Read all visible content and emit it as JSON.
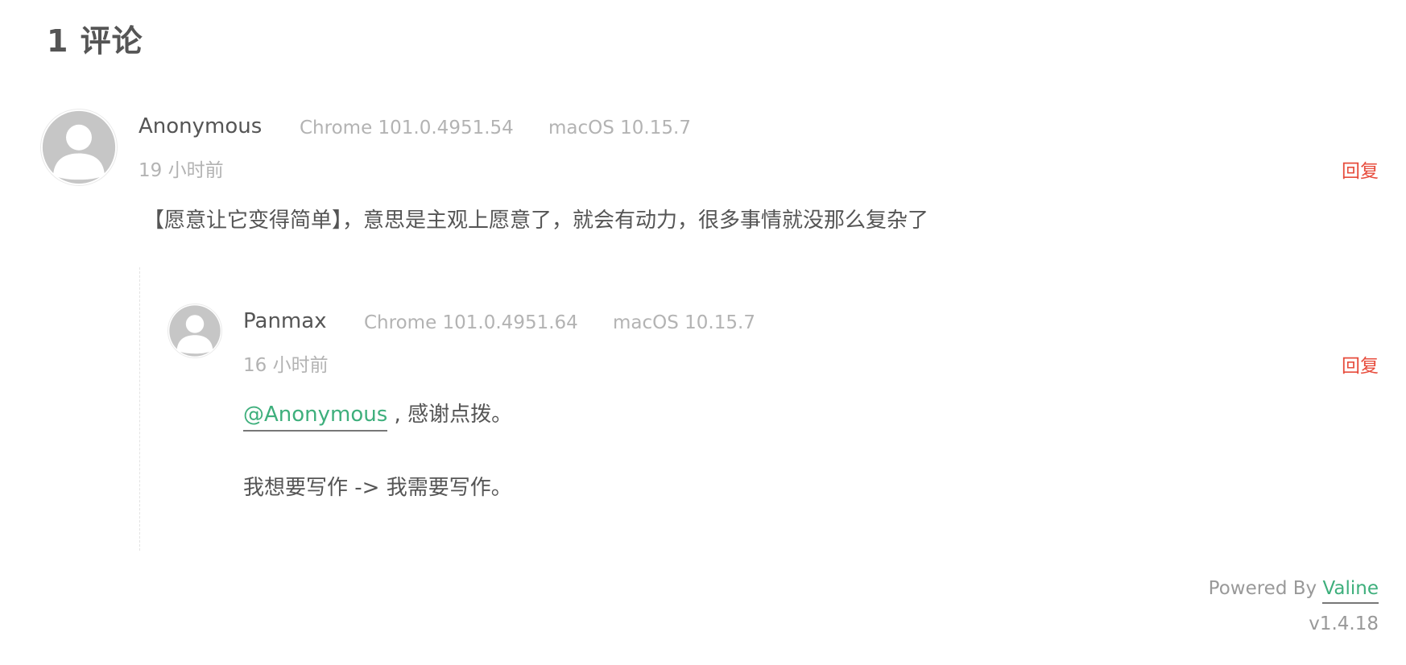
{
  "header": {
    "count_title": "1 评论"
  },
  "comments": [
    {
      "nick": "Anonymous",
      "browser": "Chrome 101.0.4951.54",
      "os": "macOS 10.15.7",
      "time": "19 小时前",
      "reply_label": "回复",
      "content": "【愿意让它变得简单】，意思是主观上愿意了，就会有动力，很多事情就没那么复杂了",
      "replies": [
        {
          "nick": "Panmax",
          "browser": "Chrome 101.0.4951.64",
          "os": "macOS 10.15.7",
          "time": "16 小时前",
          "reply_label": "回复",
          "mention": "@Anonymous",
          "content_line1_rest": " , 感谢点拨。",
          "content_line2": "我想要写作 -> 我需要写作。"
        }
      ]
    }
  ],
  "footer": {
    "powered_prefix": "Powered By ",
    "powered_link": "Valine",
    "version": "v1.4.18"
  },
  "colors": {
    "accent": "#3eaf7c",
    "reply": "#e74c3c",
    "meta": "#b3b3b3",
    "text": "#555555"
  },
  "icons": {
    "avatar": "default-user-avatar-icon"
  }
}
